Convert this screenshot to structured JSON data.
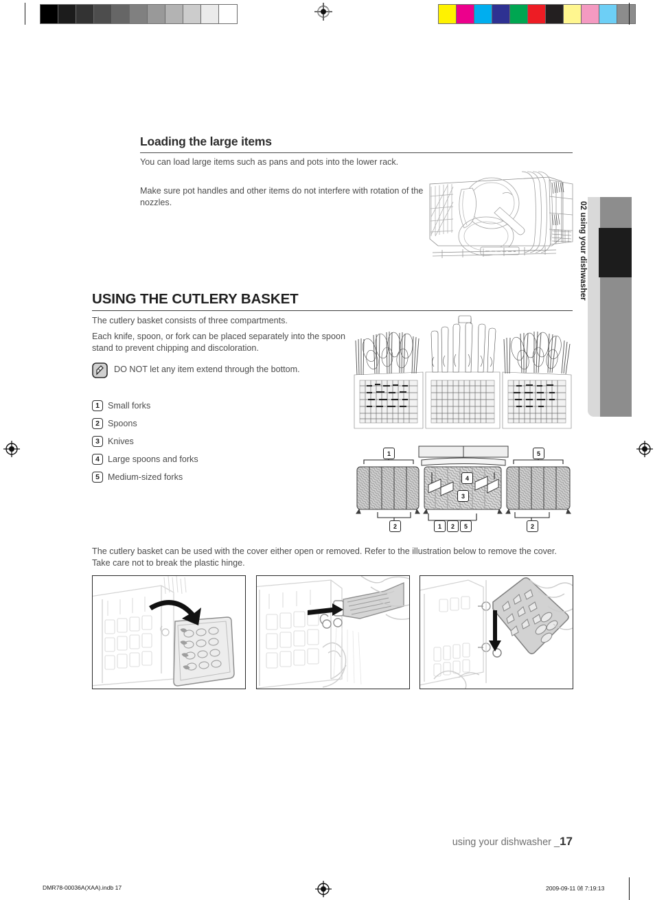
{
  "page": {
    "number": "17",
    "footer_label": "using your dishwasher _",
    "side_tab": "02 using your dishwasher"
  },
  "section_large_items": {
    "heading": "Loading the large items",
    "para1": "You can load large items such as pans and pots into the lower rack.",
    "para2": "Make sure pot handles and other items do not interfere with rotation of the nozzles.",
    "figure_alt": "lower-rack-loaded-with-pots-and-plates"
  },
  "section_cutlery": {
    "heading": "USING THE CUTLERY BASKET",
    "para1": "The cutlery basket consists of three compartments.",
    "para2": "Each knife, spoon, or fork can be placed separately into the spoon stand to prevent chipping and discoloration.",
    "note": {
      "icon": "note-pencil-icon",
      "text": "DO NOT let any item extend through the bottom."
    },
    "legend": [
      {
        "num": "1",
        "label": "Small forks"
      },
      {
        "num": "2",
        "label": "Spoons"
      },
      {
        "num": "3",
        "label": "Knives"
      },
      {
        "num": "4",
        "label": "Large spoons and forks"
      },
      {
        "num": "5",
        "label": "Medium-sized forks"
      }
    ],
    "figure_basket_alt": "cutlery-basket-three-compartments-filled",
    "figure_callouts_alt": "cutlery-basket-top-view-with-numbered-callouts",
    "callout_numbers_top": [
      "1",
      "5"
    ],
    "callout_numbers_inner": [
      "4",
      "3"
    ],
    "callout_numbers_bottom": [
      "2",
      "1",
      "2",
      "5",
      "2"
    ],
    "para3": "The cutlery basket can be used with the cover either open or removed. Refer to the illustration below to remove the cover. Take care not to break the plastic hinge.",
    "steps": [
      {
        "alt": "step-1-flip-cover-open-arrow-down"
      },
      {
        "alt": "step-2-slide-hinge-sideways-arrow-right"
      },
      {
        "alt": "step-3-lift-cover-off-arrow-down"
      }
    ]
  },
  "print_marks": {
    "gray_ramp": [
      "#000000",
      "#1c1c1c",
      "#333333",
      "#4d4d4d",
      "#666666",
      "#808080",
      "#999999",
      "#b3b3b3",
      "#cccccc",
      "#ebebeb",
      "#ffffff"
    ],
    "color_bars": [
      "#fff200",
      "#ec008c",
      "#00aeef",
      "#2e3192",
      "#00a651",
      "#ed1c24",
      "#231f20",
      "#fff68f",
      "#f49ac1",
      "#6dcff6",
      "#8c8c8c"
    ],
    "registration_icon": "registration-target-icon",
    "footer_file": "DMR78-00036A(XAA).indb   17",
    "footer_page": "",
    "footer_date": "2009-09-11   ㍘ 7:19:13"
  }
}
